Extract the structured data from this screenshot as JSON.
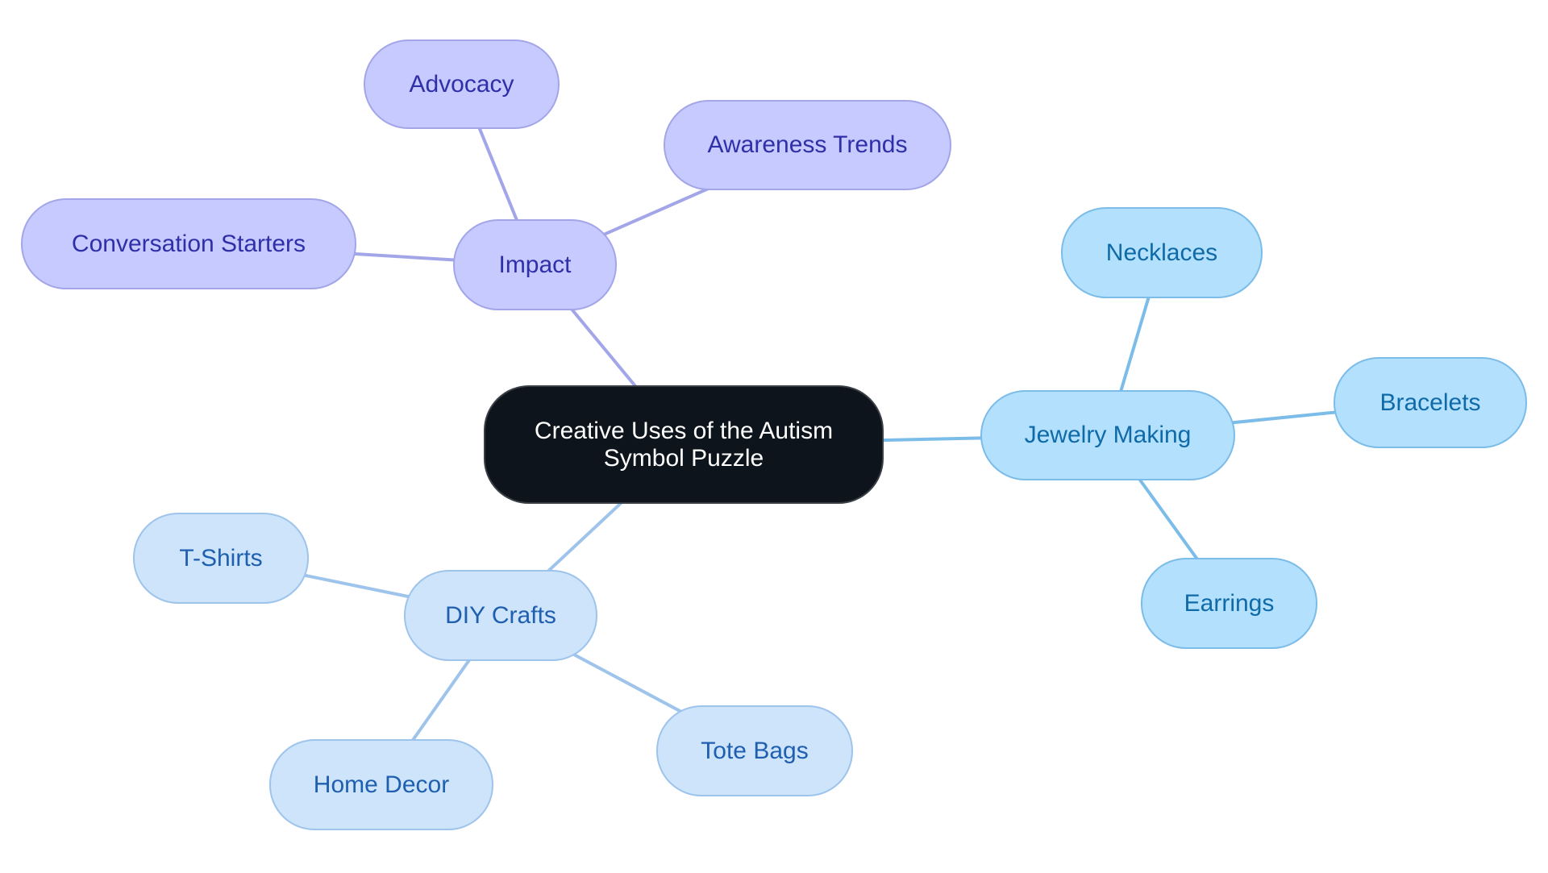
{
  "diagram": {
    "type": "mindmap",
    "root": {
      "id": "root",
      "label": "Creative Uses of the Autism Symbol Puzzle"
    },
    "branches": [
      {
        "id": "impact",
        "label": "Impact",
        "theme": "purple",
        "children": [
          {
            "id": "advocacy",
            "label": "Advocacy"
          },
          {
            "id": "awareness-trends",
            "label": "Awareness Trends"
          },
          {
            "id": "conversation-starters",
            "label": "Conversation Starters"
          }
        ]
      },
      {
        "id": "jewelry-making",
        "label": "Jewelry Making",
        "theme": "sky",
        "children": [
          {
            "id": "necklaces",
            "label": "Necklaces"
          },
          {
            "id": "bracelets",
            "label": "Bracelets"
          },
          {
            "id": "earrings",
            "label": "Earrings"
          }
        ]
      },
      {
        "id": "diy-crafts",
        "label": "DIY Crafts",
        "theme": "pale",
        "children": [
          {
            "id": "t-shirts",
            "label": "T-Shirts"
          },
          {
            "id": "home-decor",
            "label": "Home Decor"
          },
          {
            "id": "tote-bags",
            "label": "Tote Bags"
          }
        ]
      }
    ],
    "colors": {
      "root_fill": "#0d141b",
      "purple_fill": "#c7caff",
      "purple_edge": "#a2a6e8",
      "purple_text": "#2f2fa8",
      "sky_fill": "#b3e0fd",
      "sky_edge": "#7bbce8",
      "sky_text": "#0f6aa8",
      "pale_fill": "#cde4fb",
      "pale_edge": "#9ec4ec",
      "pale_text": "#1f5fb0"
    }
  }
}
